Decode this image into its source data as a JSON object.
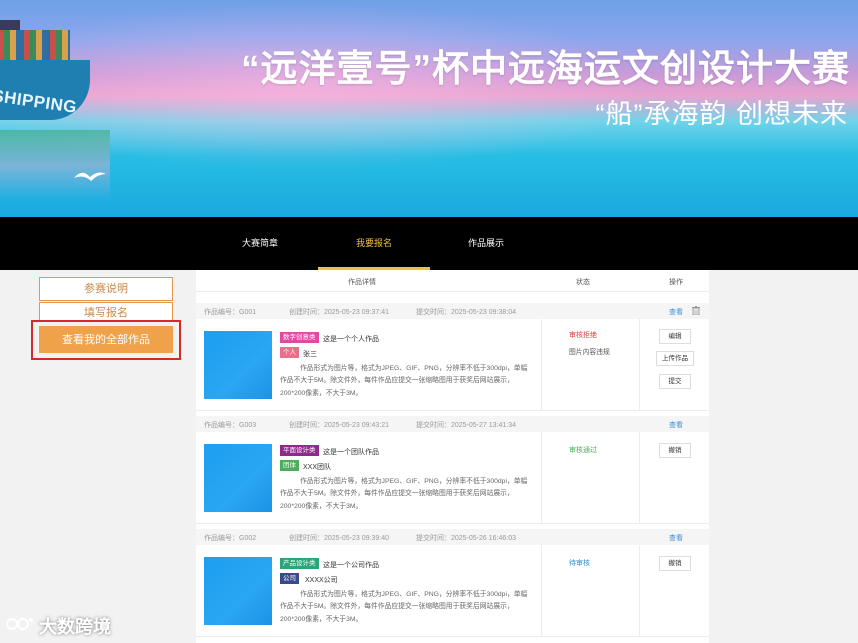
{
  "banner": {
    "title": "“远洋壹号”杯中远海运文创设计大赛",
    "subtitle": "“船”承海韵 创想未来",
    "ship_text": "SHIPPING"
  },
  "nav": {
    "items": [
      {
        "label": "大赛简章",
        "active": false
      },
      {
        "label": "我要报名",
        "active": true
      },
      {
        "label": "作品展示",
        "active": false
      }
    ]
  },
  "sidebar": {
    "items": [
      {
        "label": "参赛说明"
      },
      {
        "label": "填写报名"
      },
      {
        "label": "查看我的全部作品",
        "highlighted": true
      }
    ]
  },
  "table": {
    "headers": {
      "detail": "作品详情",
      "status": "状态",
      "action": "操作"
    }
  },
  "works": [
    {
      "no": "作品编号：G001",
      "created": "创建时间：2025-05-23 09:37:41",
      "submitted": "提交时间：2025-05-23 09:38:04",
      "view": "查看",
      "category": "数字创意类",
      "category_color": "#e04aa0",
      "name": "这是一个个人作品",
      "kind": "个人",
      "kind_color": "#e8708a",
      "owner": "张三",
      "desc": "作品形式为图片等，格式为JPEG、GIF、PNG，分辨率不低于300dpi，单幅作品不大于5M。除文件外，每件作品应提交一张缩略图用于获奖后网站展示，200*200像素，不大于3M。",
      "status": "审核拒绝",
      "status_color": "#e0393e",
      "status_note": "图片内容违规",
      "actions": [
        "编辑",
        "上传作品",
        "提交"
      ],
      "show_trash": true
    },
    {
      "no": "作品编号：G003",
      "created": "创建时间：2025-05-23 09:43:21",
      "submitted": "提交时间：2025-05-27 13:41:34",
      "view": "查看",
      "category": "平面设计类",
      "category_color": "#8e2a8a",
      "name": "这是一个团队作品",
      "kind": "团体",
      "kind_color": "#4cae5c",
      "owner": "XXX团队",
      "desc": "作品形式为图片等，格式为JPEG、GIF、PNG，分辨率不低于300dpi，单幅作品不大于5M。除文件外，每件作品应提交一张缩略图用于获奖后网站展示，200*200像素，不大于3M。",
      "status": "审核通过",
      "status_color": "#4cae5c",
      "status_note": "",
      "actions": [
        "撤销"
      ],
      "show_trash": false
    },
    {
      "no": "作品编号：G002",
      "created": "创建时间：2025-05-23 09:39:40",
      "submitted": "提交时间：2025-05-26 16:46:03",
      "view": "查看",
      "category": "产品设计类",
      "category_color": "#2aa57a",
      "name": "这是一个公司作品",
      "kind": "公司",
      "kind_color": "#3b4a8c",
      "owner": "XXXX公司",
      "desc": "作品形式为图片等，格式为JPEG、GIF、PNG，分辨率不低于300dpi，单幅作品不大于5M。除文件外，每件作品应提交一张缩略图用于获奖后网站展示，200*200像素，不大于3M。",
      "status": "待审核",
      "status_color": "#2a8fd6",
      "status_note": "",
      "actions": [
        "撤销"
      ],
      "show_trash": false
    }
  ],
  "watermark": {
    "text": "大数跨境",
    "logo": "logo-mark"
  }
}
